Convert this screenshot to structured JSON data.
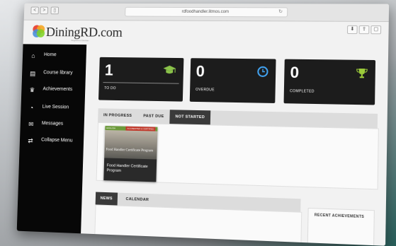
{
  "browser": {
    "url": "rdfoodhandler.litmos.com",
    "nav_back": "<",
    "nav_forward": ">"
  },
  "brand": {
    "name": "DiningRD.com",
    "tagline": "Registered Dietitian"
  },
  "sidebar": {
    "items": [
      {
        "label": "Home",
        "icon": "home-icon"
      },
      {
        "label": "Course library",
        "icon": "book-icon"
      },
      {
        "label": "Achievements",
        "icon": "trophy-icon"
      },
      {
        "label": "Live Session",
        "icon": "live-session-icon"
      },
      {
        "label": "Messages",
        "icon": "envelope-icon"
      },
      {
        "label": "Collapse Menu",
        "icon": "collapse-icon"
      }
    ]
  },
  "stats": [
    {
      "value": "1",
      "label": "TO DO",
      "icon": "graduation-cap-icon"
    },
    {
      "value": "0",
      "label": "OVERDUE",
      "icon": "clock-icon"
    },
    {
      "value": "0",
      "label": "COMPLETED",
      "icon": "trophy-icon"
    }
  ],
  "course_tabs": [
    {
      "label": "IN PROGRESS"
    },
    {
      "label": "PAST DUE"
    },
    {
      "label": "NOT STARTED",
      "active": true
    }
  ],
  "courses": [
    {
      "title": "Food Handler Certificate Program",
      "overlay": "Food Handler Certificate Program",
      "ribbon_left": "ENGLISH",
      "ribbon_right": "ACCREDITED & CERTIFIED"
    }
  ],
  "bottom_tabs": [
    {
      "label": "NEWS",
      "active": true
    },
    {
      "label": "CALENDAR"
    }
  ],
  "achievements": {
    "title": "RECENT ACHIEVEMENTS"
  },
  "colors": {
    "sidebar_bg": "#070707",
    "card_bg": "#1c1c1c",
    "accent_green": "#8bc34a",
    "accent_blue": "#42a5f5",
    "trophy_green": "#9ccc3a"
  }
}
